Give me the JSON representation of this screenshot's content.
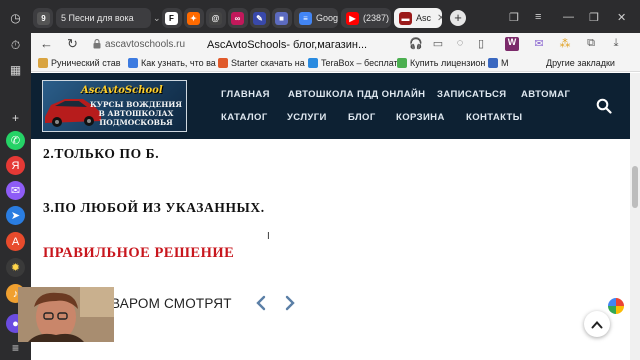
{
  "browser": {
    "tabs": [
      {
        "label": "9",
        "icon": "tab-counter"
      },
      {
        "label": "5  Песни для вока",
        "icon": "music-note-icon"
      },
      {
        "label": "",
        "icon": "f-logo-icon"
      },
      {
        "label": "",
        "icon": "flame-icon"
      },
      {
        "label": "",
        "icon": "at-icon"
      },
      {
        "label": "",
        "icon": "infinity-icon"
      },
      {
        "label": "",
        "icon": "pencil-icon"
      },
      {
        "label": "",
        "icon": "puzzle-icon"
      },
      {
        "label": "Google",
        "icon": "docs-icon"
      },
      {
        "label": "(2387)",
        "icon": "youtube-icon"
      },
      {
        "label": "Asc",
        "icon": "site-favicon"
      }
    ],
    "address": {
      "domain": "ascavtoschools.ru",
      "title": "AscAvtoSchools- блог,магазин..."
    },
    "bookmarks": [
      {
        "label": "Рунический став",
        "color": "#d9a441"
      },
      {
        "label": "Как узнать, что ва",
        "color": "#3d7be0"
      },
      {
        "label": "Starter скачать на",
        "color": "#e05a2b"
      },
      {
        "label": "TeraBox – бесплат",
        "color": "#2a8be0"
      },
      {
        "label": "Купить лицензион",
        "color": "#4caf50"
      },
      {
        "label": "M",
        "color": "#3a68c0"
      }
    ],
    "bookmarks_other": "Другие закладки"
  },
  "site": {
    "logo": {
      "title": "AscAvtoSchool",
      "subtitle": "КУРСЫ ВОЖДЕНИЯ В АВТОШКОЛАХ ПОДМОСКОВЬЯ"
    },
    "menu_row1": [
      "ГЛАВНАЯ",
      "АВТОШКОЛА ПДД ОНЛАЙН",
      "ЗАПИСАТЬСЯ",
      "АВТОМАГ"
    ],
    "menu_row2": [
      "КАТАЛОГ",
      "УСЛУГИ",
      "БЛОГ",
      "КОРЗИНА",
      "КОНТАКТЫ"
    ]
  },
  "content": {
    "answer_2": "2.ТОЛЬКО ПО Б.",
    "answer_3": "3.ПО ЛЮБОЙ ИЗ УКАЗАННЫХ.",
    "correct_label": "ПРАВИЛЬНОЕ РЕШЕНИЕ",
    "also_watch": "ВАРОМ СМОТРЯТ"
  },
  "colors": {
    "header_bg": "#0d2133",
    "correct_red": "#c8161d",
    "browser_dark": "#2c2c2e"
  }
}
